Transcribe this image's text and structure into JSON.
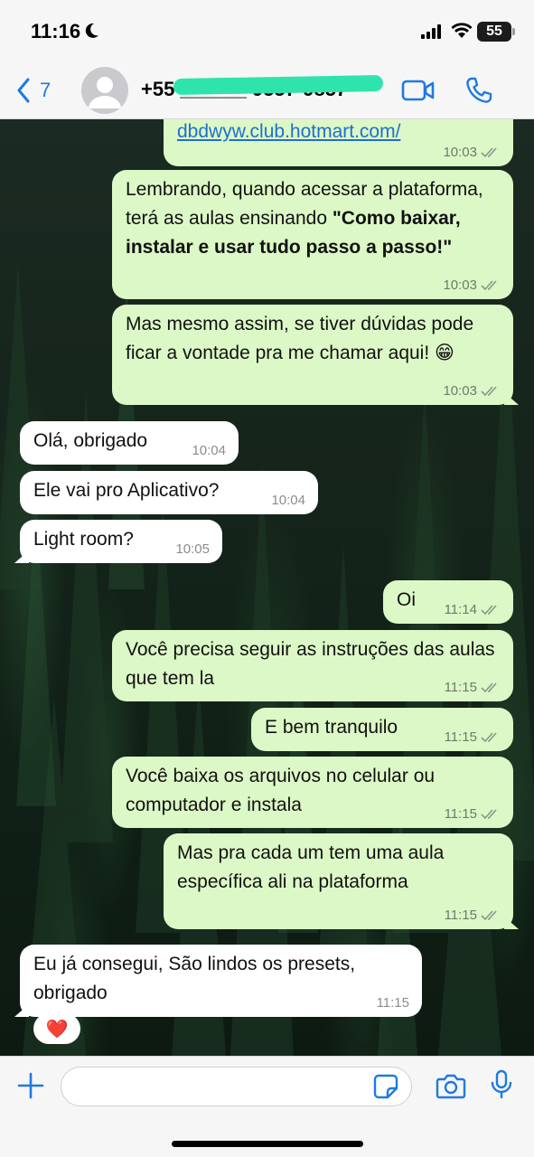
{
  "status_bar": {
    "time": "11:16",
    "battery": "55"
  },
  "header": {
    "back_count": "7",
    "contact_name": "+55 ______ 9557-9857",
    "icons": [
      "back-chevron-icon",
      "avatar-icon",
      "video-call-icon",
      "phone-call-icon"
    ]
  },
  "messages": [
    {
      "dir": "out",
      "parts": [
        {
          "t": "dbdwyw.club.hotmart.com/",
          "link": true
        }
      ],
      "time": "10:03",
      "status": "read"
    },
    {
      "dir": "out",
      "parts": [
        {
          "t": "Lembrando, quando acessar a plataforma, terá as aulas ensinando "
        },
        {
          "t": "\"Como baixar, instalar e usar tudo passo a passo!\"",
          "bold": true
        }
      ],
      "time": "10:03",
      "status": "read"
    },
    {
      "dir": "out",
      "parts": [
        {
          "t": "Mas mesmo assim, se tiver dúvidas pode ficar a vontade pra me chamar aqui! 😁"
        }
      ],
      "time": "10:03",
      "status": "read"
    },
    {
      "dir": "in",
      "parts": [
        {
          "t": "Olá, obrigado"
        }
      ],
      "time": "10:04"
    },
    {
      "dir": "in",
      "parts": [
        {
          "t": "Ele vai pro Aplicativo?"
        }
      ],
      "time": "10:04"
    },
    {
      "dir": "in",
      "parts": [
        {
          "t": "Light room?"
        }
      ],
      "time": "10:05"
    },
    {
      "dir": "out",
      "parts": [
        {
          "t": "Oi"
        }
      ],
      "time": "11:14",
      "status": "read"
    },
    {
      "dir": "out",
      "parts": [
        {
          "t": "Você precisa seguir as instruções das aulas que tem la"
        }
      ],
      "time": "11:15",
      "status": "read"
    },
    {
      "dir": "out",
      "parts": [
        {
          "t": "E bem tranquilo"
        }
      ],
      "time": "11:15",
      "status": "read"
    },
    {
      "dir": "out",
      "parts": [
        {
          "t": "Você baixa os arquivos no celular ou computador e instala"
        }
      ],
      "time": "11:15",
      "status": "read"
    },
    {
      "dir": "out",
      "parts": [
        {
          "t": "Mas pra cada um tem uma aula específica ali na plataforma"
        }
      ],
      "time": "11:15",
      "status": "read"
    },
    {
      "dir": "in",
      "parts": [
        {
          "t": "Eu já consegui, São lindos os presets, obrigado"
        }
      ],
      "time": "11:15",
      "reaction": "❤️"
    }
  ],
  "input": {
    "placeholder": "",
    "icons": [
      "plus-icon",
      "sticker-icon",
      "camera-icon",
      "microphone-icon"
    ]
  },
  "colors": {
    "outgoing_bubble": "#dcf8c6",
    "incoming_bubble": "#ffffff",
    "accent": "#1f7ae0",
    "redaction": "#2fe3ad"
  }
}
